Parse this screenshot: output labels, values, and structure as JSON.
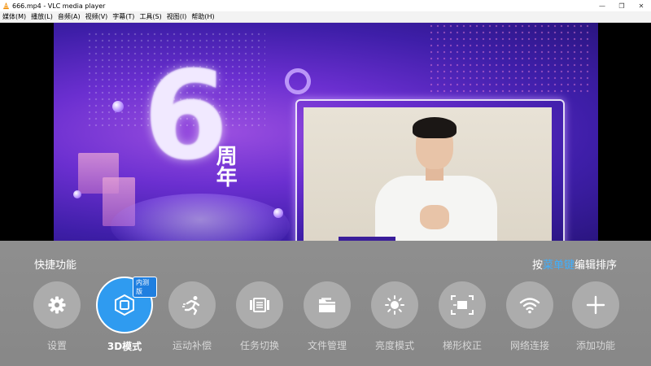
{
  "window": {
    "title": "666.mp4 - VLC media player",
    "minimize": "—",
    "restore": "❐",
    "close": "✕"
  },
  "menu": [
    "媒体(M)",
    "播放(L)",
    "音频(A)",
    "视频(V)",
    "字幕(T)",
    "工具(S)",
    "视图(I)",
    "帮助(H)"
  ],
  "video": {
    "number": "6",
    "overlay_text": "周年"
  },
  "panel": {
    "title": "快捷功能",
    "hint_prefix": "按",
    "hint_key": "菜单键",
    "hint_suffix": "编辑排序",
    "accent_color": "#3fb0ff",
    "items": [
      {
        "label": "设置",
        "icon": "gear-icon"
      },
      {
        "label": "3D模式",
        "icon": "cube-icon",
        "badge": "内测版",
        "active": true
      },
      {
        "label": "运动补偿",
        "icon": "runner-icon"
      },
      {
        "label": "任务切换",
        "icon": "task-switch-icon"
      },
      {
        "label": "文件管理",
        "icon": "folder-icon"
      },
      {
        "label": "亮度模式",
        "icon": "sun-icon"
      },
      {
        "label": "梯形校正",
        "icon": "keystone-icon"
      },
      {
        "label": "网络连接",
        "icon": "wifi-icon"
      },
      {
        "label": "添加功能",
        "icon": "plus-icon"
      }
    ]
  }
}
